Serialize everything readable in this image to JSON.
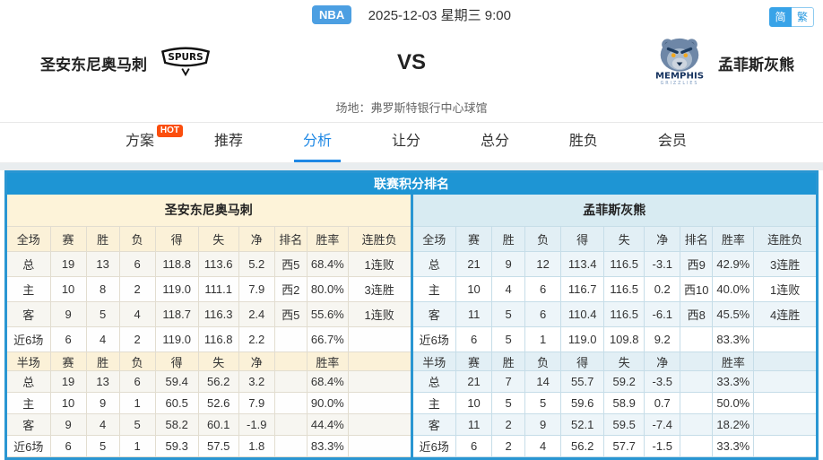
{
  "top_bar": {
    "league_badge": "NBA",
    "datetime": "2025-12-03 星期三 9:00",
    "lang_simplified": "简",
    "lang_traditional": "繁"
  },
  "match_header": {
    "home_team": "圣安东尼奥马刺",
    "away_team": "孟菲斯灰熊",
    "vs_label": "VS",
    "venue": "场地：弗罗斯特银行中心球馆",
    "home_logo_text": "SPURS",
    "away_logo_text_line1": "MEMPHIS",
    "away_logo_text_line2": "GRIZZLIES"
  },
  "nav": {
    "items": [
      {
        "key": "plan",
        "label": "方案",
        "badge": "HOT",
        "active": false
      },
      {
        "key": "recommend",
        "label": "推荐",
        "active": false
      },
      {
        "key": "analysis",
        "label": "分析",
        "active": true
      },
      {
        "key": "handicap",
        "label": "让分",
        "active": false
      },
      {
        "key": "total",
        "label": "总分",
        "active": false
      },
      {
        "key": "winloss",
        "label": "胜负",
        "active": false
      },
      {
        "key": "member",
        "label": "会员",
        "active": false
      }
    ]
  },
  "colors": {
    "accent_blue": "#1e95d4",
    "home_header_bg": "#fdf3d9",
    "away_header_bg": "#d8ebf2",
    "stat_red": "#ff0000",
    "streak_loss_green": "#009900",
    "hot_badge_bg": "#fb4e0e"
  },
  "standings": {
    "title": "联赛积分排名",
    "home": {
      "team": "圣安东尼奥马刺",
      "full_headers": [
        "全场",
        "赛",
        "胜",
        "负",
        "得",
        "失",
        "净",
        "排名",
        "胜率",
        "连胜负"
      ],
      "full_rows": [
        {
          "label": "总",
          "played": "19",
          "win": "13",
          "loss": "6",
          "pts_for": "118.8",
          "pts_against": "113.6",
          "diff": "5.2",
          "rank": "西5",
          "rate": "68.4%",
          "streak": "1连败",
          "streak_type": "loss"
        },
        {
          "label": "主",
          "played": "10",
          "win": "8",
          "loss": "2",
          "pts_for": "119.0",
          "pts_against": "111.1",
          "diff": "7.9",
          "rank": "西2",
          "rate": "80.0%",
          "streak": "3连胜",
          "streak_type": "win"
        },
        {
          "label": "客",
          "played": "9",
          "win": "5",
          "loss": "4",
          "pts_for": "118.7",
          "pts_against": "116.3",
          "diff": "2.4",
          "rank": "西5",
          "rate": "55.6%",
          "streak": "1连败",
          "streak_type": "loss"
        },
        {
          "label": "近6场",
          "played": "6",
          "win": "4",
          "loss": "2",
          "pts_for": "119.0",
          "pts_against": "116.8",
          "diff": "2.2",
          "rank": "",
          "rate": "66.7%",
          "streak": "",
          "streak_type": ""
        }
      ],
      "half_headers": [
        "半场",
        "赛",
        "胜",
        "负",
        "得",
        "失",
        "净",
        "",
        "胜率",
        ""
      ],
      "half_rows": [
        {
          "label": "总",
          "played": "19",
          "win": "13",
          "loss": "6",
          "pts_for": "59.4",
          "pts_against": "56.2",
          "diff": "3.2",
          "rate": "68.4%"
        },
        {
          "label": "主",
          "played": "10",
          "win": "9",
          "loss": "1",
          "pts_for": "60.5",
          "pts_against": "52.6",
          "diff": "7.9",
          "rate": "90.0%"
        },
        {
          "label": "客",
          "played": "9",
          "win": "4",
          "loss": "5",
          "pts_for": "58.2",
          "pts_against": "60.1",
          "diff": "-1.9",
          "rate": "44.4%"
        },
        {
          "label": "近6场",
          "played": "6",
          "win": "5",
          "loss": "1",
          "pts_for": "59.3",
          "pts_against": "57.5",
          "diff": "1.8",
          "rate": "83.3%"
        }
      ]
    },
    "away": {
      "team": "孟菲斯灰熊",
      "full_headers": [
        "全场",
        "赛",
        "胜",
        "负",
        "得",
        "失",
        "净",
        "排名",
        "胜率",
        "连胜负"
      ],
      "full_rows": [
        {
          "label": "总",
          "played": "21",
          "win": "9",
          "loss": "12",
          "pts_for": "113.4",
          "pts_against": "116.5",
          "diff": "-3.1",
          "rank": "西9",
          "rate": "42.9%",
          "streak": "3连胜",
          "streak_type": "win"
        },
        {
          "label": "主",
          "played": "10",
          "win": "4",
          "loss": "6",
          "pts_for": "116.7",
          "pts_against": "116.5",
          "diff": "0.2",
          "rank": "西10",
          "rate": "40.0%",
          "streak": "1连败",
          "streak_type": "loss"
        },
        {
          "label": "客",
          "played": "11",
          "win": "5",
          "loss": "6",
          "pts_for": "110.4",
          "pts_against": "116.5",
          "diff": "-6.1",
          "rank": "西8",
          "rate": "45.5%",
          "streak": "4连胜",
          "streak_type": "win"
        },
        {
          "label": "近6场",
          "played": "6",
          "win": "5",
          "loss": "1",
          "pts_for": "119.0",
          "pts_against": "109.8",
          "diff": "9.2",
          "rank": "",
          "rate": "83.3%",
          "streak": "",
          "streak_type": ""
        }
      ],
      "half_headers": [
        "半场",
        "赛",
        "胜",
        "负",
        "得",
        "失",
        "净",
        "",
        "胜率",
        ""
      ],
      "half_rows": [
        {
          "label": "总",
          "played": "21",
          "win": "7",
          "loss": "14",
          "pts_for": "55.7",
          "pts_against": "59.2",
          "diff": "-3.5",
          "rate": "33.3%"
        },
        {
          "label": "主",
          "played": "10",
          "win": "5",
          "loss": "5",
          "pts_for": "59.6",
          "pts_against": "58.9",
          "diff": "0.7",
          "rate": "50.0%"
        },
        {
          "label": "客",
          "played": "11",
          "win": "2",
          "loss": "9",
          "pts_for": "52.1",
          "pts_against": "59.5",
          "diff": "-7.4",
          "rate": "18.2%"
        },
        {
          "label": "近6场",
          "played": "6",
          "win": "2",
          "loss": "4",
          "pts_for": "56.2",
          "pts_against": "57.7",
          "diff": "-1.5",
          "rate": "33.3%"
        }
      ]
    }
  }
}
